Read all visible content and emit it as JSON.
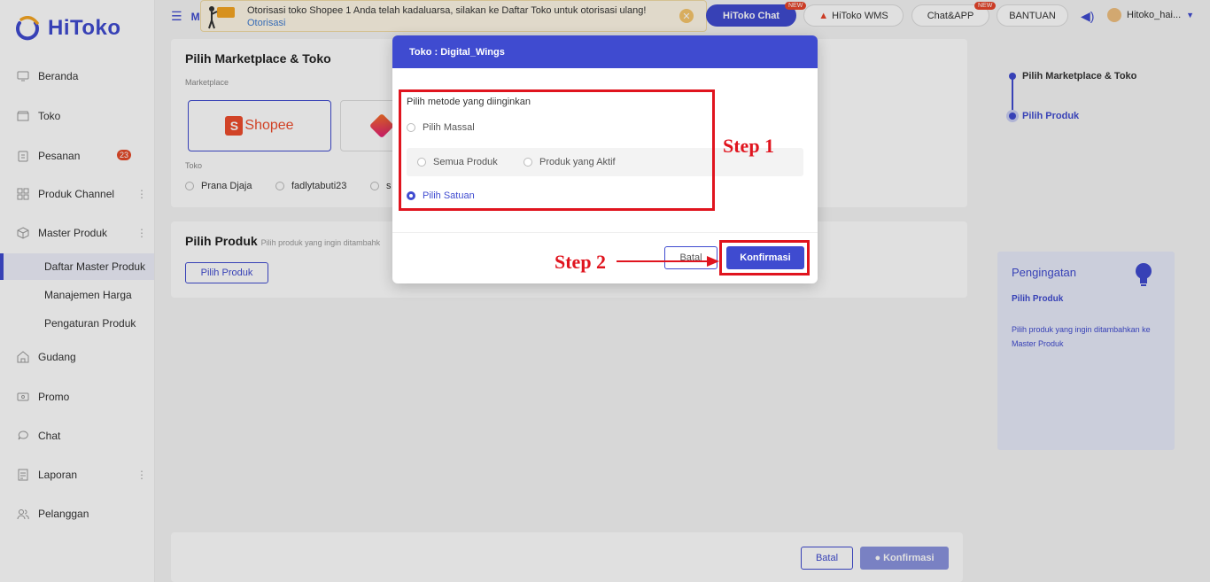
{
  "brand": {
    "name": "HiToko"
  },
  "sidebar": {
    "items": [
      {
        "label": "Beranda",
        "icon": "monitor-icon"
      },
      {
        "label": "Toko",
        "icon": "store-icon"
      },
      {
        "label": "Pesanan",
        "icon": "clipboard-icon",
        "badge": "23"
      },
      {
        "label": "Produk Channel",
        "icon": "grid-icon"
      },
      {
        "label": "Master Produk",
        "icon": "cube-icon"
      },
      {
        "label": "Gudang",
        "icon": "warehouse-icon"
      },
      {
        "label": "Promo",
        "icon": "ticket-icon"
      },
      {
        "label": "Chat",
        "icon": "chat-icon"
      },
      {
        "label": "Laporan",
        "icon": "report-icon"
      },
      {
        "label": "Pelanggan",
        "icon": "users-icon"
      }
    ],
    "sub_items": [
      "Daftar Master Produk",
      "Manajemen Harga",
      "Pengaturan Produk"
    ],
    "more_glyph": "⋮"
  },
  "topbar": {
    "breadcrumb": "M",
    "notification": {
      "message": "Otorisasi toko Shopee 1 Anda telah kadaluarsa, silakan ke Daftar Toko untuk otorisasi ulang!",
      "link": "Otorisasi"
    },
    "hitoko_chat": "HiToko Chat",
    "hitoko_wms": "HiToko WMS",
    "chat_app": "Chat&APP",
    "bantuan": "BANTUAN",
    "new_tag": "NEW",
    "user": "Hitoko_hai..."
  },
  "page": {
    "select_title": "Pilih Marketplace & Toko",
    "marketplace_label": "Marketplace",
    "shopee_label": "Shopee",
    "toko_label": "Toko",
    "shops": [
      "Prana Djaja",
      "fadlytabuti23",
      "s"
    ],
    "product_title": "Pilih Produk",
    "product_hint": "Pilih produk yang ingin ditambahk",
    "pilih_produk_button": "Pilih Produk",
    "bottom_batal": "Batal",
    "bottom_konfirmasi": "Konfirmasi"
  },
  "steps_panel": {
    "steps": [
      "Pilih Marketplace & Toko",
      "Pilih Produk"
    ]
  },
  "reminder": {
    "title": "Pengingatan",
    "subtitle": "Pilih Produk",
    "text": "Pilih produk yang ingin ditambahkan ke Master Produk"
  },
  "dialog": {
    "title": "Toko : Digital_Wings",
    "prompt": "Pilih metode yang diinginkan",
    "massal": "Pilih Massal",
    "semua": "Semua Produk",
    "aktif": "Produk yang Aktif",
    "satuan": "Pilih Satuan",
    "batal": "Batal",
    "konfirmasi": "Konfirmasi"
  },
  "annotations": {
    "step1": "Step 1",
    "step2": "Step 2"
  }
}
